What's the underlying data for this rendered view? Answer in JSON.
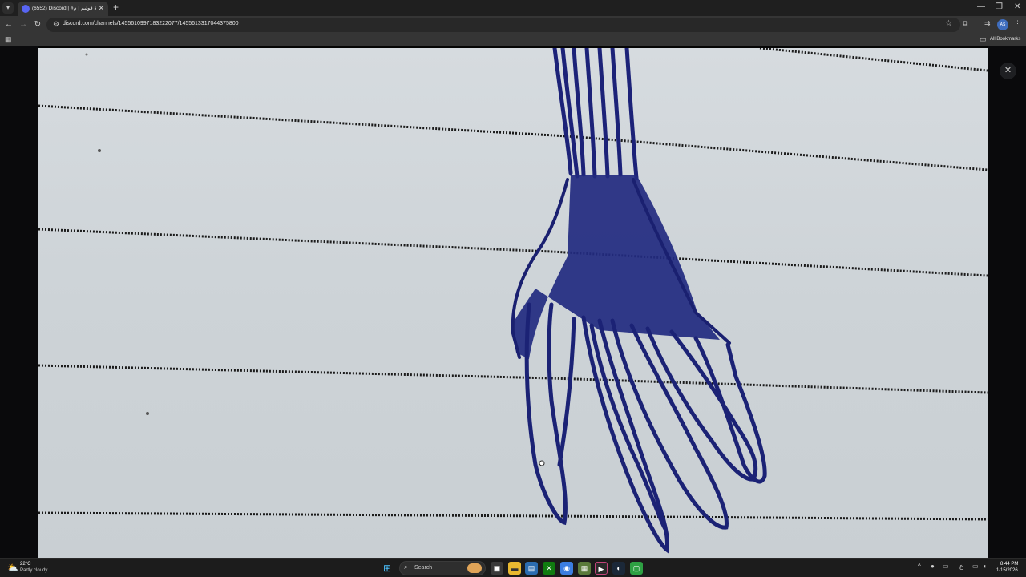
{
  "browser": {
    "tab_title": "(6552) Discord | #مدينة قوليم | م",
    "url": "discord.com/channels/1455610997183222077/1455613317044375800",
    "all_bookmarks_label": "All Bookmarks",
    "profile_initials": "AS"
  },
  "viewer": {
    "close_label": "✕"
  },
  "taskbar": {
    "weather_temp": "22°C",
    "weather_desc": "Partly cloudy",
    "search_label": "Search",
    "time": "8:44 PM",
    "date": "1/15/2026"
  }
}
